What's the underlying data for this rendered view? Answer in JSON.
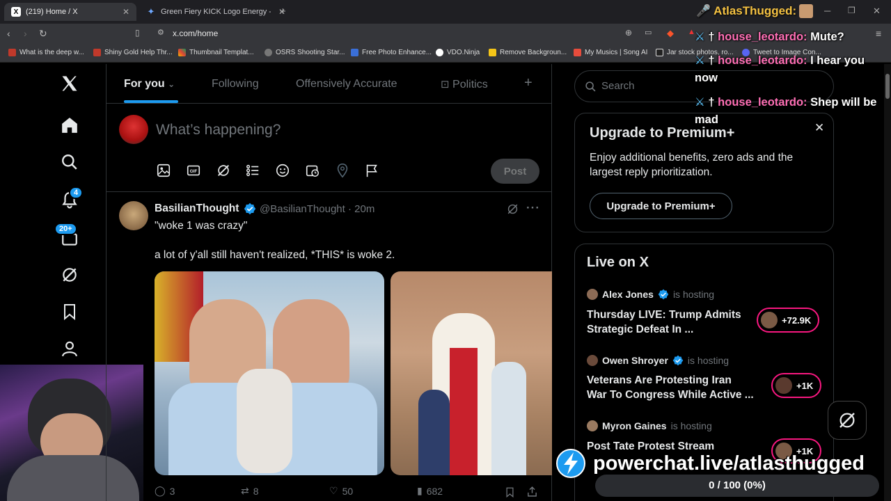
{
  "browser": {
    "tabs": [
      {
        "title": "(219) Home / X",
        "active": true
      },
      {
        "title": "Green Fiery KICK Logo Energy - Goo"
      }
    ],
    "url": "x.com/home",
    "bookmarks": [
      "What is the deep w...",
      "Shiny Gold Help Thr...",
      "Thumbnail Templat...",
      "OSRS Shooting Star...",
      "Free Photo Enhance...",
      "VDO.Ninja",
      "Remove Backgroun...",
      "My Musics | Song AI",
      "Jar stock photos, ro...",
      "Tweet to Image Con..."
    ]
  },
  "stream": {
    "streamer_name": "AtlasThugged:",
    "chat": [
      {
        "user": "house_leotardo:",
        "message": "Mute?"
      },
      {
        "user": "house_leotardo:",
        "message": "I hear you now"
      },
      {
        "user": "house_leotardo:",
        "message": "Shep will be mad"
      }
    ],
    "powerchat_url": "powerchat.live/atlasthugged",
    "goal_progress": "0 / 100 (0%)",
    "goal_fraction": 0
  },
  "nav": {
    "notifications_badge": "4",
    "messages_badge": "20+"
  },
  "tabs": {
    "for_you": "For you",
    "following": "Following",
    "offensively_accurate": "Offensively Accurate",
    "politics": "Politics",
    "add": "+"
  },
  "composer": {
    "placeholder": "What’s happening?",
    "post_label": "Post"
  },
  "tweet": {
    "display_name": "BasilianThought",
    "handle_time": "@BasilianThought · 20m",
    "text_line1": "\"woke 1 was crazy\"",
    "text_line2": "a lot of y'all still haven't realized, *THIS* is woke 2.",
    "replies": "3",
    "reposts": "8",
    "likes": "50",
    "views": "682"
  },
  "search": {
    "placeholder": "Search"
  },
  "premium": {
    "title": "Upgrade to Premium+",
    "body": "Enjoy additional benefits, zero ads and the largest reply prioritization.",
    "button": "Upgrade to Premium+"
  },
  "live": {
    "heading": "Live on X",
    "hosting_label": "is hosting",
    "items": [
      {
        "host": "Alex Jones",
        "title": "Thursday LIVE: Trump Admits Strategic Defeat In ...",
        "count": "+72.9K"
      },
      {
        "host": "Owen Shroyer",
        "title": "Veterans Are Protesting Iran War To Congress While Active ...",
        "count": "+1K"
      },
      {
        "host": "Myron Gaines",
        "title": "Post Tate Protest Stream",
        "count": "+1K"
      }
    ]
  },
  "colors": {
    "accent": "#1d9bf0",
    "background": "#000000",
    "border": "#2f3336",
    "live_pink": "#f91880"
  }
}
